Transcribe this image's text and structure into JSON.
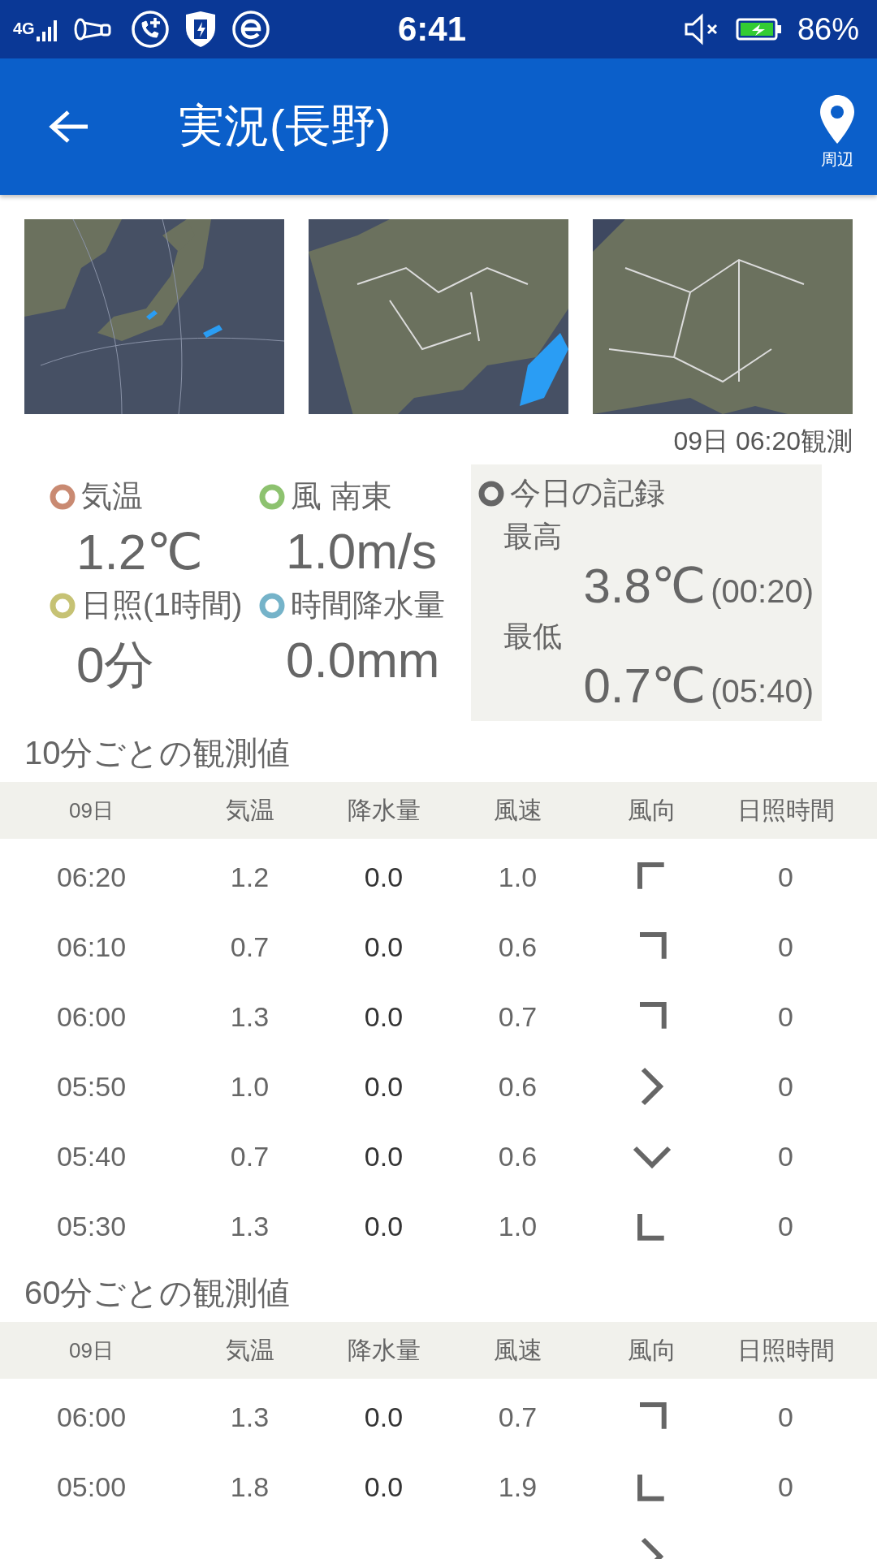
{
  "status_bar": {
    "network": "4G",
    "time": "6:41",
    "battery": "86%"
  },
  "app_bar": {
    "title": "実況(長野)",
    "action_label": "周辺"
  },
  "observed_at": "09日 06:20観測",
  "current": [
    {
      "label": "気温",
      "color": "#c98a72",
      "value": "1.2℃"
    },
    {
      "label": "風 南東",
      "color": "#8dc26f",
      "value": "1.0m/s"
    },
    {
      "label": "日照(1時間)",
      "color": "#c6c274",
      "value": "0分"
    },
    {
      "label": "時間降水量",
      "color": "#75b3c9",
      "value": "0.0mm"
    }
  ],
  "today_record": {
    "title": "今日の記録",
    "items": [
      {
        "label": "最高",
        "value": "3.8℃",
        "time": "(00:20)"
      },
      {
        "label": "最低",
        "value": "0.7℃",
        "time": "(05:40)"
      }
    ]
  },
  "tables": [
    {
      "title": "10分ごとの観測値",
      "columns": [
        "09日",
        "気温",
        "降水量",
        "風速",
        "風向",
        "日照時間"
      ],
      "rows": [
        {
          "time": "06:20",
          "temp": "1.2",
          "precip": "0.0",
          "speed": "1.0",
          "kind": "se",
          "sun": "0"
        },
        {
          "time": "06:10",
          "temp": "0.7",
          "precip": "0.0",
          "speed": "0.6",
          "kind": "sw",
          "sun": "0"
        },
        {
          "time": "06:00",
          "temp": "1.3",
          "precip": "0.0",
          "speed": "0.7",
          "kind": "sw",
          "sun": "0"
        },
        {
          "time": "05:50",
          "temp": "1.0",
          "precip": "0.0",
          "speed": "0.6",
          "kind": "w",
          "sun": "0"
        },
        {
          "time": "05:40",
          "temp": "0.7",
          "precip": "0.0",
          "speed": "0.6",
          "kind": "n",
          "sun": "0"
        },
        {
          "time": "05:30",
          "temp": "1.3",
          "precip": "0.0",
          "speed": "1.0",
          "kind": "ne",
          "sun": "0"
        }
      ]
    },
    {
      "title": "60分ごとの観測値",
      "columns": [
        "09日",
        "気温",
        "降水量",
        "風速",
        "風向",
        "日照時間"
      ],
      "rows": [
        {
          "time": "06:00",
          "temp": "1.3",
          "precip": "0.0",
          "speed": "0.7",
          "kind": "sw",
          "sun": "0"
        },
        {
          "time": "05:00",
          "temp": "1.8",
          "precip": "0.0",
          "speed": "1.9",
          "kind": "ne",
          "sun": "0"
        },
        {
          "kind": "w"
        }
      ]
    }
  ]
}
